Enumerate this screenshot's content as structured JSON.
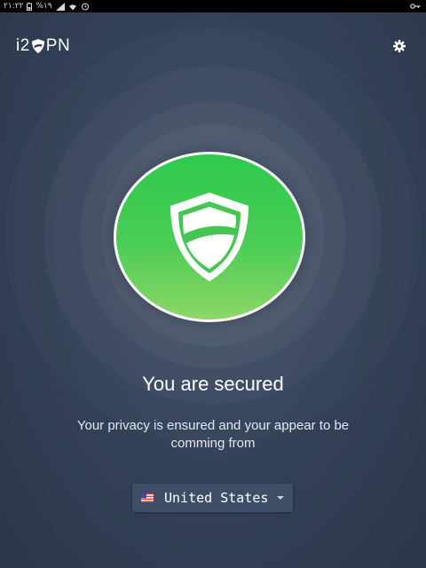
{
  "status_bar": {
    "time": "۲۱:۲۲",
    "battery": "%۱۹",
    "icons": [
      "battery-icon",
      "signal-icon",
      "wifi-icon",
      "alarm-icon",
      "key-icon"
    ]
  },
  "app": {
    "logo_prefix": "i2",
    "logo_suffix": "PN",
    "logo_icon": "shield-icon",
    "settings_icon": "gear-icon"
  },
  "status": {
    "icon": "shield-icon",
    "headline": "You are secured",
    "message": "Your privacy is ensured and your appear to be comming from"
  },
  "location": {
    "flag_icon": "us-flag-icon",
    "selected": "United States"
  },
  "colors": {
    "background": "#34425a",
    "secure_green": "#3cc852",
    "selector_bg": "#3f4e67"
  }
}
